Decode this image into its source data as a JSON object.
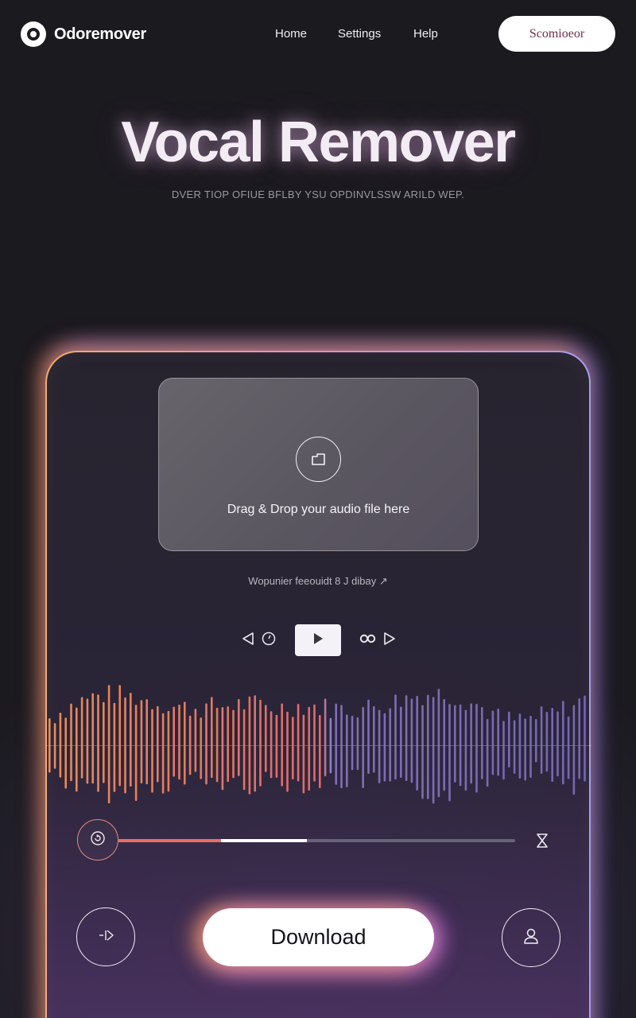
{
  "nav": {
    "brand": "Odoremover",
    "links": [
      "Home",
      "Settings",
      "Help"
    ],
    "cta": "Scomioeor"
  },
  "hero": {
    "title": "Vocal Remover",
    "subtitle": "DVER TIOP OFIUE BFLBY YSU OPDINVLSSW ARILD WEP."
  },
  "upload": {
    "drop_text": "Drag & Drop your audio file here",
    "icon": "folder-icon"
  },
  "status": {
    "text": "Wopunier feeouidt 8 J dibay ↗"
  },
  "player": {
    "icons": [
      "rewind-icon",
      "timer-icon",
      "play-icon",
      "loop-icon",
      "forward-icon"
    ],
    "progress": {
      "played": 0.26,
      "buffered_to": 0.476
    }
  },
  "actions": {
    "download": "Download",
    "left_icon": "split-audio-icon",
    "right_icon": "user-icon"
  },
  "colors": {
    "accent_orange": "#ea6f63",
    "accent_purple": "#a49cff",
    "cta_text": "#6b2e4a"
  }
}
